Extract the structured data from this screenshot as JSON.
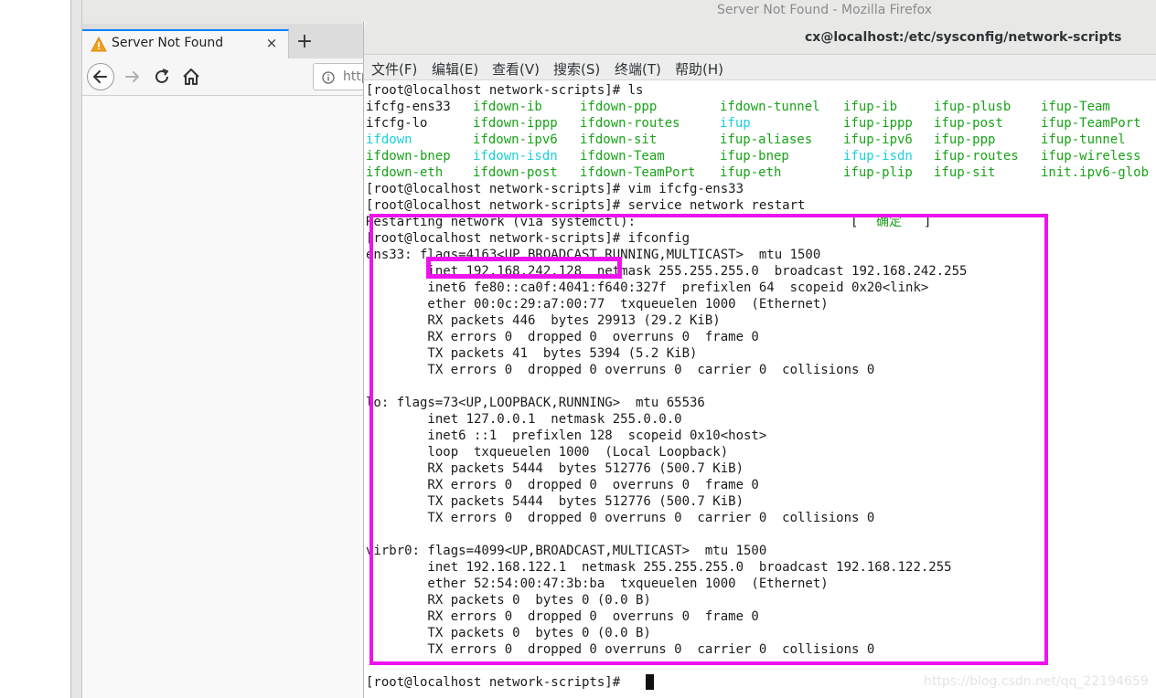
{
  "firefox": {
    "window_title": "Server Not Found - Mozilla Firefox",
    "tab_title": "Server Not Found",
    "tab_close": "×",
    "new_tab": "+",
    "url_partial": "http"
  },
  "terminal": {
    "window_title": "cx@localhost:/etc/sysconfig/network-scripts",
    "menu": [
      "文件(F)",
      "编辑(E)",
      "查看(V)",
      "搜索(S)",
      "终端(T)",
      "帮助(H)"
    ],
    "prompt1": "[root@localhost network-scripts]# ls",
    "ls_rows": [
      [
        "ifcfg-ens33",
        "ifdown-ib",
        "ifdown-ppp",
        "ifdown-tunnel",
        "ifup-ib",
        "ifup-plusb",
        "ifup-Team"
      ],
      [
        "ifcfg-lo",
        "ifdown-ippp",
        "ifdown-routes",
        "ifup",
        "ifup-ippp",
        "ifup-post",
        "ifup-TeamPort"
      ],
      [
        "ifdown",
        "ifdown-ipv6",
        "ifdown-sit",
        "ifup-aliases",
        "ifup-ipv6",
        "ifup-ppp",
        "ifup-tunnel"
      ],
      [
        "ifdown-bnep",
        "ifdown-isdn",
        "ifdown-Team",
        "ifup-bnep",
        "ifup-isdn",
        "ifup-routes",
        "ifup-wireless"
      ],
      [
        "ifdown-eth",
        "ifdown-post",
        "ifdown-TeamPort",
        "ifup-eth",
        "ifup-plip",
        "ifup-sit",
        "init.ipv6-glob"
      ]
    ],
    "prompt2": "[root@localhost network-scripts]# vim ifcfg-ens33",
    "prompt3": "[root@localhost network-scripts]# service network restart",
    "restart_msg": "Restarting network (via systemctl):",
    "restart_status_open": "[",
    "restart_status": "确定",
    "restart_status_close": "]",
    "prompt4": "[root@localhost network-scripts]# ifconfig",
    "ifconfig": [
      "ens33: flags=4163<UP,BROADCAST,RUNNING,MULTICAST>  mtu 1500",
      "        inet 192.168.242.128  netmask 255.255.255.0  broadcast 192.168.242.255",
      "        inet6 fe80::ca0f:4041:f640:327f  prefixlen 64  scopeid 0x20<link>",
      "        ether 00:0c:29:a7:00:77  txqueuelen 1000  (Ethernet)",
      "        RX packets 446  bytes 29913 (29.2 KiB)",
      "        RX errors 0  dropped 0  overruns 0  frame 0",
      "        TX packets 41  bytes 5394 (5.2 KiB)",
      "        TX errors 0  dropped 0 overruns 0  carrier 0  collisions 0",
      "",
      "lo: flags=73<UP,LOOPBACK,RUNNING>  mtu 65536",
      "        inet 127.0.0.1  netmask 255.0.0.0",
      "        inet6 ::1  prefixlen 128  scopeid 0x10<host>",
      "        loop  txqueuelen 1000  (Local Loopback)",
      "        RX packets 5444  bytes 512776 (500.7 KiB)",
      "        RX errors 0  dropped 0  overruns 0  frame 0",
      "        TX packets 5444  bytes 512776 (500.7 KiB)",
      "        TX errors 0  dropped 0 overruns 0  carrier 0  collisions 0",
      "",
      "virbr0: flags=4099<UP,BROADCAST,MULTICAST>  mtu 1500",
      "        inet 192.168.122.1  netmask 255.255.255.0  broadcast 192.168.122.255",
      "        ether 52:54:00:47:3b:ba  txqueuelen 1000  (Ethernet)",
      "        RX packets 0  bytes 0 (0.0 B)",
      "        RX errors 0  dropped 0  overruns 0  frame 0",
      "        TX packets 0  bytes 0 (0.0 B)",
      "        TX errors 0  dropped 0 overruns 0  carrier 0  collisions 0"
    ],
    "prompt_final": "[root@localhost network-scripts]#"
  },
  "colors": {
    "executable": "#18a318",
    "symlink": "#1ad0d8",
    "highlight": "#ee12ee"
  },
  "watermark": "https://blog.csdn.net/qq_22194659"
}
